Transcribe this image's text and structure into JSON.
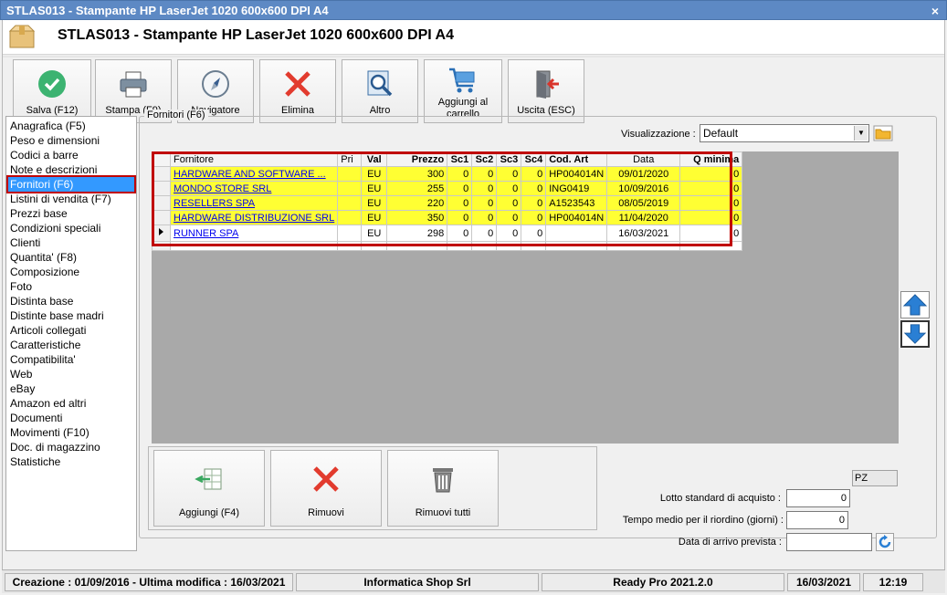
{
  "window": {
    "title": "STLAS013 - Stampante HP LaserJet 1020 600x600 DPI A4",
    "close": "×"
  },
  "header": {
    "title": "STLAS013 - Stampante HP LaserJet 1020 600x600 DPI A4"
  },
  "toolbar": {
    "save": "Salva (F12)",
    "print": "Stampa (F9)",
    "navigator": "Navigatore",
    "delete": "Elimina",
    "other": "Altro",
    "cart_line1": "Aggiungi al",
    "cart_line2": "carrello",
    "exit": "Uscita (ESC)"
  },
  "nav": [
    "Anagrafica (F5)",
    "Peso e dimensioni",
    "Codici a barre",
    "Note e descrizioni",
    "Fornitori (F6)",
    "Listini di vendita (F7)",
    "Prezzi base",
    "Condizioni speciali",
    "Clienti",
    "Quantita' (F8)",
    "Composizione",
    "Foto",
    "Distinta base",
    "Distinte base madri",
    "Articoli collegati",
    "Caratteristiche",
    "Compatibilita'",
    "Web",
    "eBay",
    "Amazon ed altri",
    "Documenti",
    "Movimenti (F10)",
    "Doc. di magazzino",
    "Statistiche"
  ],
  "nav_selected": 4,
  "panel": {
    "group_label": "Fornitori (F6)",
    "vis_label": "Visualizzazione :",
    "vis_value": "Default"
  },
  "grid": {
    "headers": [
      "Fornitore",
      "Pri",
      "Val",
      "Prezzo",
      "Sc1",
      "Sc2",
      "Sc3",
      "Sc4",
      "Cod. Art",
      "Data",
      "Q minima"
    ],
    "rows": [
      [
        "HARDWARE AND SOFTWARE ...",
        "",
        "EU",
        "300",
        "0",
        "0",
        "0",
        "0",
        "HP004014N",
        "09/01/2020",
        "0"
      ],
      [
        "MONDO STORE SRL",
        "",
        "EU",
        "255",
        "0",
        "0",
        "0",
        "0",
        "ING0419",
        "10/09/2016",
        "0"
      ],
      [
        "RESELLERS SPA",
        "",
        "EU",
        "220",
        "0",
        "0",
        "0",
        "0",
        "A1523543",
        "08/05/2019",
        "0"
      ],
      [
        "HARDWARE DISTRIBUZIONE SRL",
        "",
        "EU",
        "350",
        "0",
        "0",
        "0",
        "0",
        "HP004014N",
        "11/04/2020",
        "0"
      ],
      [
        "RUNNER SPA",
        "",
        "EU",
        "298",
        "0",
        "0",
        "0",
        "0",
        "",
        "16/03/2021",
        "0"
      ]
    ]
  },
  "bottom": {
    "add": "Aggiungi (F4)",
    "remove": "Rimuovi",
    "remove_all": "Rimuovi tutti"
  },
  "fields": {
    "lot_label": "Lotto standard di acquisto :",
    "lot_value": "0",
    "lot_unit": "PZ",
    "time_label": "Tempo medio per il riordino (giorni) :",
    "time_value": "0",
    "arrival_label": "Data di arrivo prevista :",
    "arrival_value": ""
  },
  "status": {
    "created": "Creazione : 01/09/2016 - Ultima modifica : 16/03/2021",
    "company": "Informatica Shop Srl",
    "state": "Ready Pro 2021.2.0",
    "date": "16/03/2021",
    "time": "12:19"
  },
  "colors": {
    "highlight_row": "#ffff33",
    "selection": "#3399ff",
    "frame": "#c00000",
    "titlebar": "#5d89c4"
  }
}
